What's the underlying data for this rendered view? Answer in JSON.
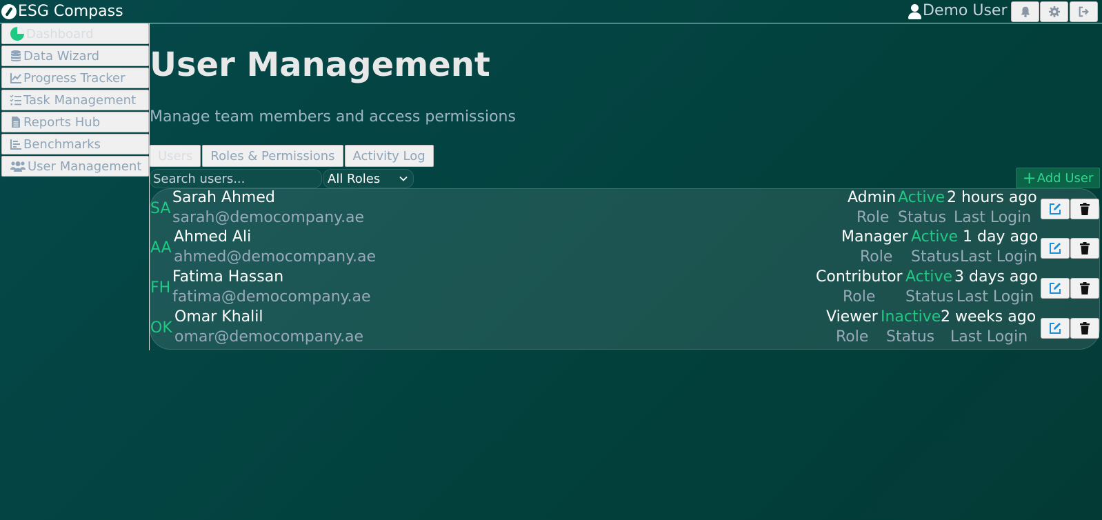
{
  "app": {
    "title": "ESG Compass",
    "user_name": "Demo User"
  },
  "sidebar": {
    "items": [
      {
        "label": "Dashboard",
        "icon": "chart-pie-icon"
      },
      {
        "label": "Data Wizard",
        "icon": "database-icon"
      },
      {
        "label": "Progress Tracker",
        "icon": "line-chart-icon"
      },
      {
        "label": "Task Management",
        "icon": "task-list-icon"
      },
      {
        "label": "Reports Hub",
        "icon": "file-icon"
      },
      {
        "label": "Benchmarks",
        "icon": "bar-chart-icon"
      },
      {
        "label": "User Management",
        "icon": "users-icon"
      }
    ],
    "active_index": 0
  },
  "page": {
    "title": "User Management",
    "subtitle": "Manage team members and access permissions"
  },
  "tabs": [
    {
      "label": "Users",
      "active": true
    },
    {
      "label": "Roles & Permissions",
      "active": false
    },
    {
      "label": "Activity Log",
      "active": false
    }
  ],
  "filters": {
    "search_placeholder": "Search users...",
    "role_selected": "All Roles",
    "add_user_label": "Add User"
  },
  "users": [
    {
      "initials": "SA",
      "name": "Sarah Ahmed",
      "email": "sarah@democompany.ae",
      "role": "Admin",
      "status": "Active",
      "last_login": "2 hours ago"
    },
    {
      "initials": "AA",
      "name": "Ahmed Ali",
      "email": "ahmed@democompany.ae",
      "role": "Manager",
      "status": "Active",
      "last_login": "1 day ago"
    },
    {
      "initials": "FH",
      "name": "Fatima Hassan",
      "email": "fatima@democompany.ae",
      "role": "Contributor",
      "status": "Active",
      "last_login": "3 days ago"
    },
    {
      "initials": "OK",
      "name": "Omar Khalil",
      "email": "omar@democompany.ae",
      "role": "Viewer",
      "status": "Inactive",
      "last_login": "2 weeks ago"
    }
  ],
  "labels": {
    "role": "Role",
    "status": "Status",
    "last_login": "Last Login"
  },
  "colors": {
    "accent": "#1fc984",
    "background": "#02413d",
    "muted_text": "#98aab8"
  }
}
